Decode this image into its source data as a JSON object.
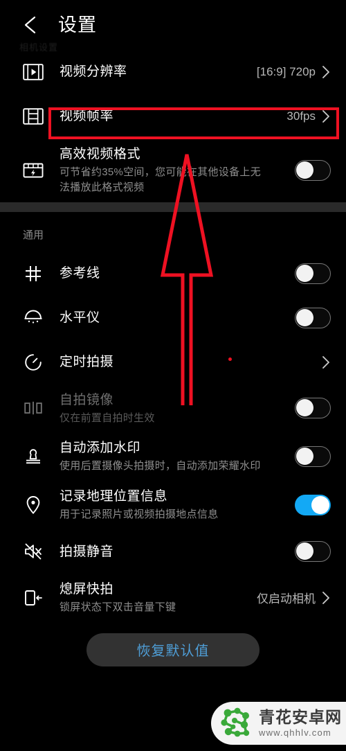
{
  "header": {
    "back_icon": "arrow-left-icon",
    "title": "设置",
    "faint_overlay_text": "相机设置"
  },
  "sections": [
    {
      "id": "video",
      "label": "",
      "rows": [
        {
          "id": "video-resolution",
          "icon": "film-play-icon",
          "title": "视频分辨率",
          "subtitle": "",
          "value": "[16:9] 720p",
          "control": "chevron"
        },
        {
          "id": "video-framerate",
          "icon": "film-strip-icon",
          "title": "视频帧率",
          "subtitle": "",
          "value": "30fps",
          "control": "chevron",
          "highlighted": true
        },
        {
          "id": "efficient-video-format",
          "icon": "clapper-bolt-icon",
          "title": "高效视频格式",
          "subtitle": "可节省约35%空间，您可能在其他设备上无法播放此格式视频",
          "value": "",
          "control": "toggle",
          "toggle_state": "off"
        }
      ]
    },
    {
      "id": "general",
      "label": "通用",
      "rows": [
        {
          "id": "grid-lines",
          "icon": "grid-icon",
          "title": "参考线",
          "subtitle": "",
          "value": "",
          "control": "toggle",
          "toggle_state": "off"
        },
        {
          "id": "level-meter",
          "icon": "level-horizon-icon",
          "title": "水平仪",
          "subtitle": "",
          "value": "",
          "control": "toggle",
          "toggle_state": "off"
        },
        {
          "id": "timed-capture",
          "icon": "timer-icon",
          "title": "定时拍摄",
          "subtitle": "",
          "value": "",
          "control": "chevron"
        },
        {
          "id": "selfie-mirror",
          "icon": "mirror-icon",
          "title": "自拍镜像",
          "subtitle": "仅在前置自拍时生效",
          "value": "",
          "control": "toggle",
          "toggle_state": "off",
          "disabled": true
        },
        {
          "id": "auto-watermark",
          "icon": "stamp-icon",
          "title": "自动添加水印",
          "subtitle": "使用后置摄像头拍摄时，自动添加荣耀水印",
          "value": "",
          "control": "toggle",
          "toggle_state": "off"
        },
        {
          "id": "record-location",
          "icon": "location-pin-icon",
          "title": "记录地理位置信息",
          "subtitle": "用于记录照片或视频拍摄地点信息",
          "value": "",
          "control": "toggle",
          "toggle_state": "on"
        },
        {
          "id": "mute-shutter",
          "icon": "speaker-mute-icon",
          "title": "拍摄静音",
          "subtitle": "",
          "value": "",
          "control": "toggle",
          "toggle_state": "off"
        },
        {
          "id": "screen-off-quick-capture",
          "icon": "phone-arrow-icon",
          "title": "熄屏快拍",
          "subtitle": "锁屏状态下双击音量下键",
          "value": "仅启动相机",
          "control": "chevron"
        }
      ]
    }
  ],
  "footer": {
    "reset_label": "恢复默认值"
  },
  "annotations": {
    "highlight_color": "#ee1122",
    "highlight_target": "视频帧率",
    "arrow_direction": "up"
  },
  "watermark": {
    "site_name": "青花安卓网",
    "url": "www.qhhlv.com",
    "logo": "molecule-logo-icon"
  },
  "colors": {
    "background": "#000000",
    "toggle_on": "#13a9f5",
    "accent_red": "#ee1122",
    "reset_text": "#4f9fd8",
    "divider": "#2a2a2a"
  }
}
